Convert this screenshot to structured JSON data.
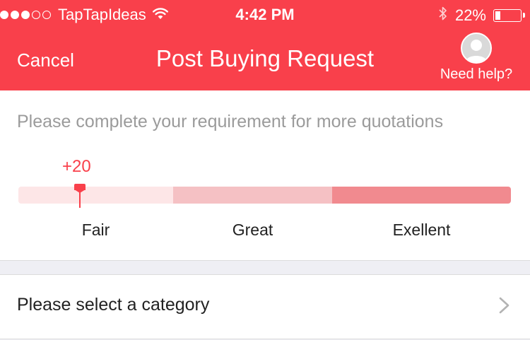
{
  "status_bar": {
    "signal_bars_filled": 3,
    "signal_bars_total": 5,
    "carrier": "TapTapIdeas",
    "time": "4:42 PM",
    "battery_percent": "22%",
    "battery_level": 0.22
  },
  "nav": {
    "cancel_label": "Cancel",
    "title": "Post Buying Request",
    "help_label": "Need help?"
  },
  "completeness": {
    "prompt": "Please complete your requirement for more quotations",
    "score_text": "+20",
    "score_value": 20,
    "levels": [
      {
        "label": "Fair",
        "color": "#fde6e7"
      },
      {
        "label": "Great",
        "color": "#f5c1c4"
      },
      {
        "label": "Exellent",
        "color": "#f18a8f"
      }
    ],
    "marker_position": 0.125
  },
  "category": {
    "label": "Please select a category"
  },
  "colors": {
    "accent": "#f9404b",
    "background": "#efeff4"
  }
}
